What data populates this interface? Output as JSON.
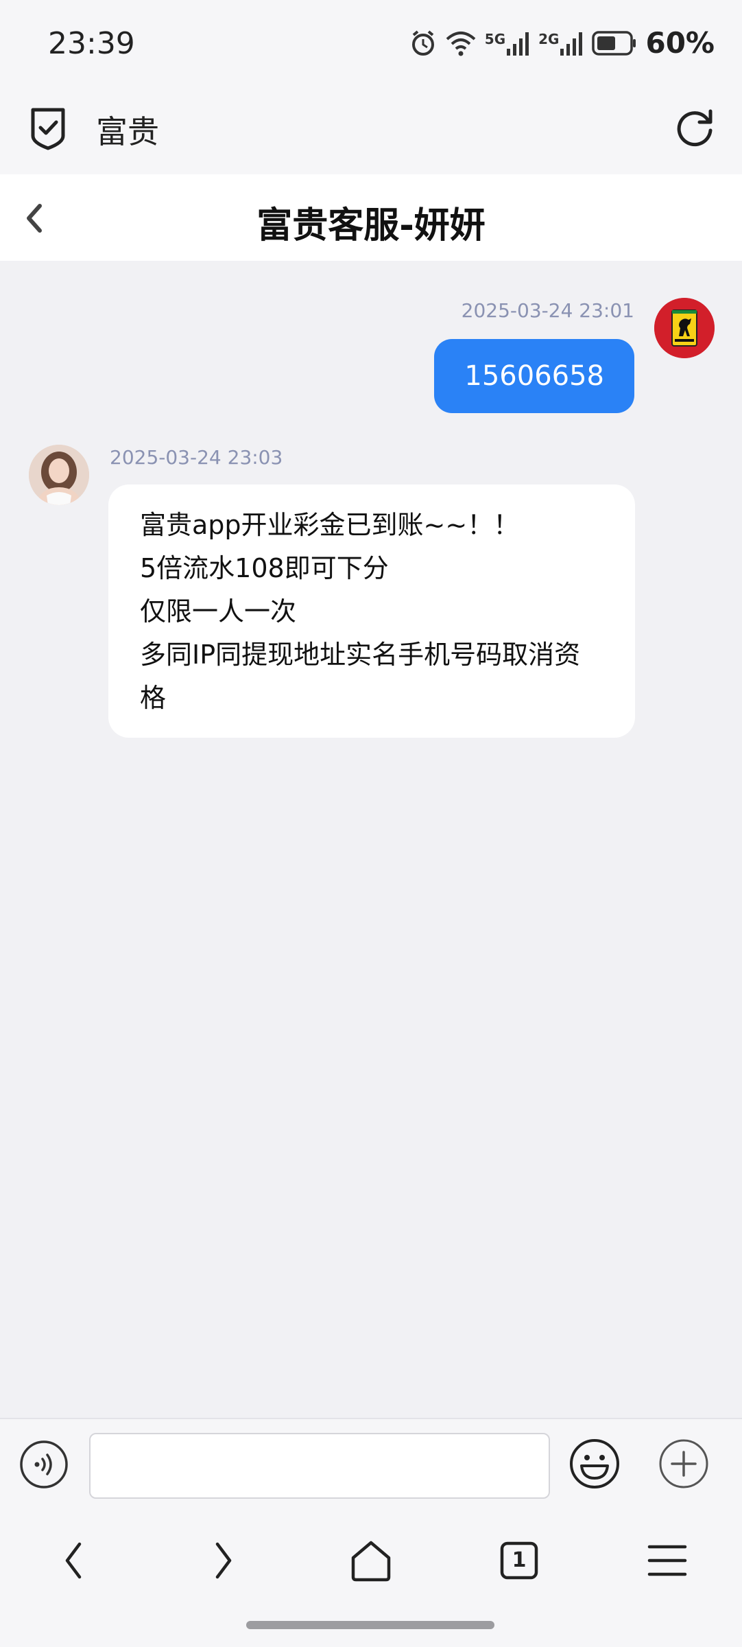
{
  "status_bar": {
    "time": "23:39",
    "network_5g": "5G",
    "network_2g": "2G",
    "battery": "60%"
  },
  "browser": {
    "site_title": "富贵"
  },
  "chat": {
    "title": "富贵客服-妍妍",
    "messages": [
      {
        "direction": "out",
        "timestamp": "2025-03-24 23:01",
        "text": "15606658"
      },
      {
        "direction": "in",
        "timestamp": "2025-03-24 23:03",
        "lines": [
          "富贵app开业彩金已到账~~！！",
          "5倍流水108即可下分",
          "仅限一人一次",
          "多同IP同提现地址实名手机号码取消资格"
        ]
      }
    ]
  },
  "input": {
    "placeholder": "",
    "value": ""
  },
  "colors": {
    "accent": "#2a82f6",
    "timestamp": "#8a92b2",
    "background": "#f1f1f4"
  },
  "icons": [
    "shield-check-icon",
    "refresh-icon",
    "back-chevron-icon",
    "voice-icon",
    "emoji-icon",
    "plus-icon",
    "nav-back-icon",
    "nav-forward-icon",
    "home-icon",
    "tabs-icon",
    "menu-icon"
  ],
  "tabs": {
    "count": "1"
  }
}
